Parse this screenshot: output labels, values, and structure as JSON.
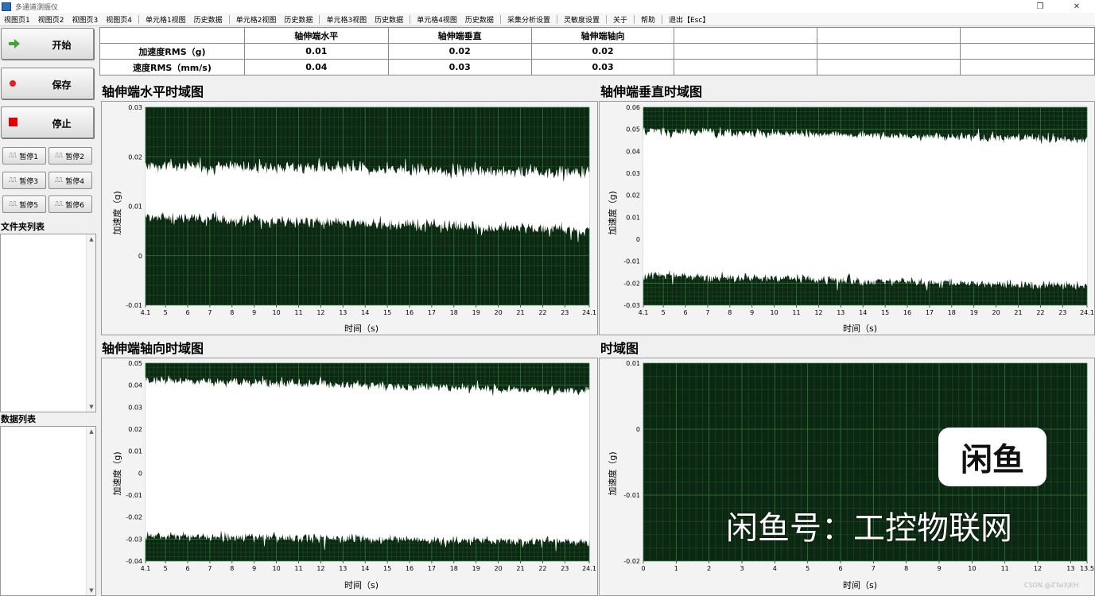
{
  "window": {
    "title": "多通道测振仪",
    "controls": [
      "❐",
      "✕"
    ]
  },
  "menu": [
    {
      "label": "视图页1"
    },
    {
      "label": "视图页2"
    },
    {
      "label": "视图页3"
    },
    {
      "label": "视图页4"
    },
    {
      "label": "单元格1视图"
    },
    {
      "label": "历史数据"
    },
    {
      "label": "单元格2视图"
    },
    {
      "label": "历史数据"
    },
    {
      "label": "单元格3视图"
    },
    {
      "label": "历史数据"
    },
    {
      "label": "单元格4视图"
    },
    {
      "label": "历史数据"
    },
    {
      "label": "采集分析设置"
    },
    {
      "label": "灵敏度设置"
    },
    {
      "label": "关于"
    },
    {
      "label": "帮助"
    },
    {
      "label": "退出【Esc】"
    }
  ],
  "sidebar": {
    "start": "开始",
    "save": "保存",
    "stop": "停止",
    "pauses": [
      "暂停1",
      "暂停2",
      "暂停3",
      "暂停4",
      "暂停5",
      "暂停6"
    ],
    "pause_icon": "⎍⎍",
    "folder_list": "文件夹列表",
    "data_list": "数据列表",
    "icons": {
      "start": "arrow-right-icon",
      "save": "record-dot-icon",
      "stop": "stop-square-icon"
    },
    "colors": {
      "start": "#3fa535",
      "save": "#e02020",
      "stop": "#e00000"
    }
  },
  "rms_table": {
    "headers": [
      "",
      "轴伸端水平",
      "轴伸端垂直",
      "轴伸端轴向",
      "",
      "",
      ""
    ],
    "rows": [
      {
        "label": "加速度RMS（g)",
        "values": [
          "0.01",
          "0.02",
          "0.02",
          "",
          "",
          ""
        ]
      },
      {
        "label": "速度RMS（mm/s)",
        "values": [
          "0.04",
          "0.03",
          "0.03",
          "",
          "",
          ""
        ]
      }
    ]
  },
  "charts_ui": [
    {
      "title": "轴伸端水平时域图",
      "ylabel": "加速度（g)",
      "xlabel": "时间（s)"
    },
    {
      "title": "轴伸端垂直时域图",
      "ylabel": "加速度（g)",
      "xlabel": "时间（s)"
    },
    {
      "title": "轴伸端轴向时域图",
      "ylabel": "加速度（g)",
      "xlabel": "时间（s)"
    },
    {
      "title": "时域图",
      "ylabel": "加速度（g)",
      "xlabel": "时间（s)"
    }
  ],
  "chart_data": [
    {
      "type": "line",
      "title": "轴伸端水平时域图",
      "xlabel": "时间（s)",
      "ylabel": "加速度（g)",
      "xlim": [
        4.1,
        24.1
      ],
      "ylim": [
        -0.01,
        0.03
      ],
      "xticks": [
        "4.1",
        "5",
        "6",
        "7",
        "8",
        "9",
        "10",
        "11",
        "12",
        "13",
        "14",
        "15",
        "16",
        "17",
        "18",
        "19",
        "20",
        "21",
        "22",
        "23",
        "24.1"
      ],
      "yticks": [
        "0.03",
        "0.02",
        "0.01",
        "0",
        "-0.01"
      ],
      "series": [
        {
          "upper_mean": [
            0.018,
            0.0165
          ],
          "lower_mean": [
            0.008,
            0.0055
          ],
          "noise": 0.0014
        }
      ],
      "grid": true
    },
    {
      "type": "line",
      "title": "轴伸端垂直时域图",
      "xlabel": "时间（s)",
      "ylabel": "加速度（g)",
      "xlim": [
        4.1,
        24.1
      ],
      "ylim": [
        -0.03,
        0.06
      ],
      "xticks": [
        "4.1",
        "5",
        "6",
        "7",
        "8",
        "9",
        "10",
        "11",
        "12",
        "13",
        "14",
        "15",
        "16",
        "17",
        "18",
        "19",
        "20",
        "21",
        "22",
        "23",
        "24.1"
      ],
      "yticks": [
        "0.06",
        "0.05",
        "0.04",
        "0.03",
        "0.02",
        "0.01",
        "0",
        "-0.01",
        "-0.02",
        "-0.03"
      ],
      "series": [
        {
          "upper_mean": [
            0.049,
            0.045
          ],
          "lower_mean": [
            -0.016,
            -0.021
          ],
          "noise": 0.0022
        }
      ],
      "grid": true
    },
    {
      "type": "line",
      "title": "轴伸端轴向时域图",
      "xlabel": "时间（s)",
      "ylabel": "加速度（g)",
      "xlim": [
        4.1,
        24.1
      ],
      "ylim": [
        -0.04,
        0.05
      ],
      "xticks": [
        "4.1",
        "5",
        "6",
        "7",
        "8",
        "9",
        "10",
        "11",
        "12",
        "13",
        "14",
        "15",
        "16",
        "17",
        "18",
        "19",
        "20",
        "21",
        "22",
        "23",
        "24.1"
      ],
      "yticks": [
        "0.05",
        "0.04",
        "0.03",
        "0.02",
        "0.01",
        "0",
        "-0.01",
        "-0.02",
        "-0.03",
        "-0.04"
      ],
      "series": [
        {
          "upper_mean": [
            0.042,
            0.037
          ],
          "lower_mean": [
            -0.028,
            -0.031
          ],
          "noise": 0.0022
        }
      ],
      "grid": true
    },
    {
      "type": "line",
      "title": "时域图",
      "xlabel": "时间（s)",
      "ylabel": "加速度（g)",
      "xlim": [
        0,
        13.5
      ],
      "ylim": [
        -0.02,
        0.01
      ],
      "xticks": [
        "0",
        "1",
        "2",
        "3",
        "4",
        "5",
        "6",
        "7",
        "8",
        "9",
        "10",
        "11",
        "12",
        "13",
        "13.5"
      ],
      "yticks": [
        "0.01",
        "0",
        "-0.01",
        "-0.02"
      ],
      "series": [],
      "grid": true
    }
  ],
  "overlay": {
    "logo": "闲鱼",
    "text": "闲鱼号：工控物联网",
    "credit": "CSDN @ZTalXJEH"
  }
}
